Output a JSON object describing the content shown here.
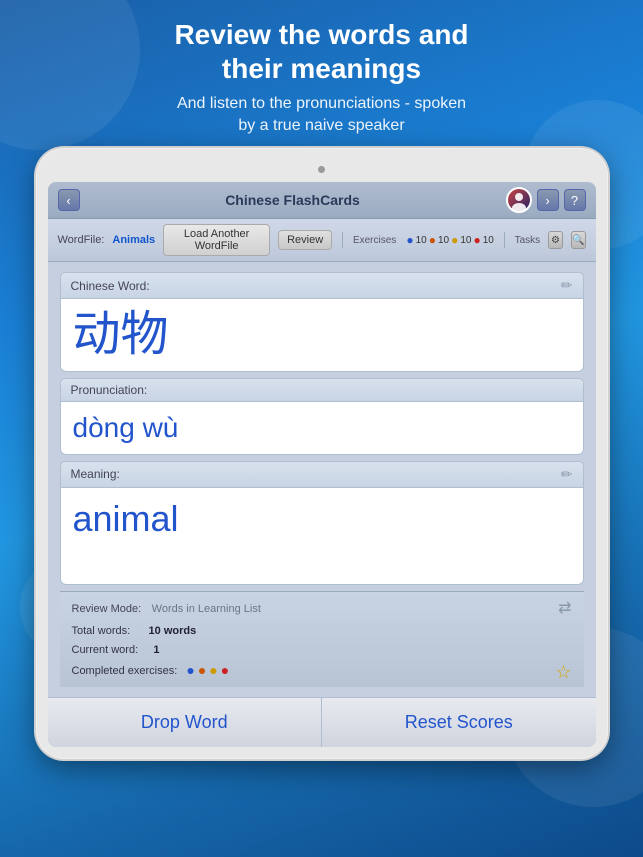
{
  "background": {
    "gradient_start": "#1a5fa8",
    "gradient_end": "#0d4a8a"
  },
  "header": {
    "title_line1": "Review the words and",
    "title_line2": "their meanings",
    "subtitle_line1": "And listen to the pronunciations - spoken",
    "subtitle_line2": "by a true naive speaker"
  },
  "app": {
    "titlebar": {
      "back_label": "‹",
      "title": "Chinese FlashCards",
      "forward_label": "›",
      "help_label": "?"
    },
    "toolbar": {
      "wordfile_label": "WordFile:",
      "wordfile_value": "Animals",
      "load_btn_label": "Load Another WordFile",
      "review_btn_label": "Review",
      "exercises_label": "Exercises",
      "score_blue": "10",
      "score_orange": "10",
      "score_yellow": "10",
      "score_red": "10",
      "tasks_label": "Tasks",
      "gear_label": "⚙",
      "search_label": "🔍"
    },
    "chinese_word": {
      "label": "Chinese Word:",
      "value": "动物"
    },
    "pronunciation": {
      "label": "Pronunciation:",
      "value": "dòng wù"
    },
    "meaning": {
      "label": "Meaning:",
      "value": "animal"
    },
    "status": {
      "review_mode_label": "Review Mode:",
      "review_mode_value": "Words in Learning List",
      "total_words_label": "Total words:",
      "total_words_value": "10 words",
      "current_word_label": "Current word:",
      "current_word_value": "1",
      "completed_exercises_label": "Completed exercises:"
    },
    "buttons": {
      "drop_word": "Drop Word",
      "reset_scores": "Reset Scores"
    }
  }
}
